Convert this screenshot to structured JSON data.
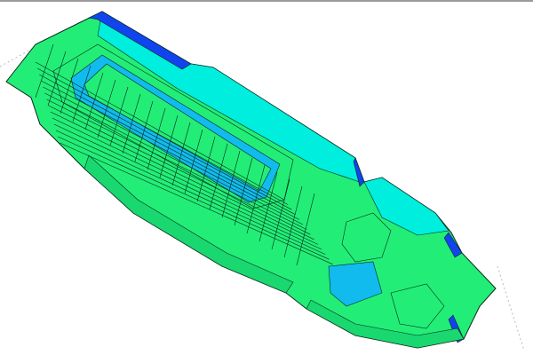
{
  "view": {
    "colors": {
      "hull": "#22ee77",
      "deck": "#00eedd",
      "shadow": "#11bbee",
      "edge_blue": "#1144ee",
      "wire": "#0a2a1a",
      "background": "#ffffff",
      "top_border": "#9a9a9a"
    }
  }
}
